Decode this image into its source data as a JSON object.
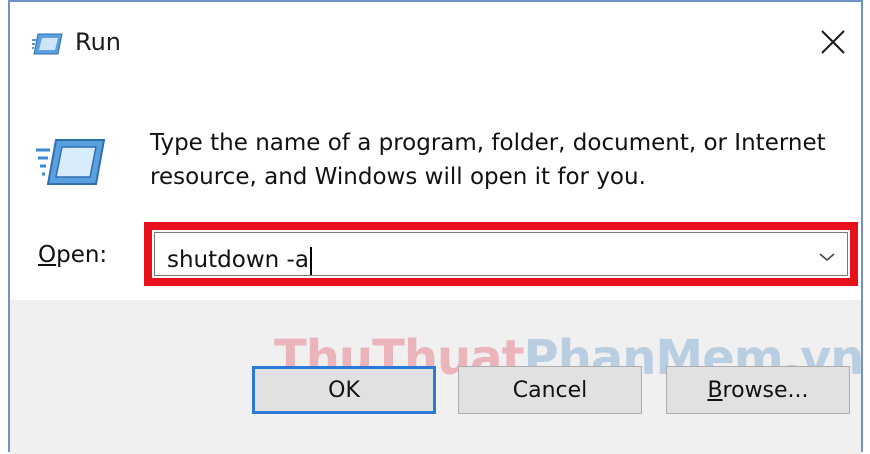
{
  "window": {
    "title": "Run",
    "title_icon": "run-icon",
    "close_icon": "close-icon"
  },
  "dialog": {
    "icon": "run-icon",
    "description": "Type the name of a program, folder, document, or Internet\nresource, and Windows will open it for you.",
    "open_label_mnemonic": "O",
    "open_label_rest": "pen:",
    "input_value": "shutdown -a",
    "dropdown_icon": "chevron-down-icon",
    "highlight_color": "#e8111b"
  },
  "buttons": {
    "ok": "OK",
    "cancel": "Cancel",
    "browse_mnemonic": "B",
    "browse_rest": "rowse..."
  },
  "watermark": {
    "part1": "ThuThuat",
    "part2": "PhanMem.vn"
  }
}
